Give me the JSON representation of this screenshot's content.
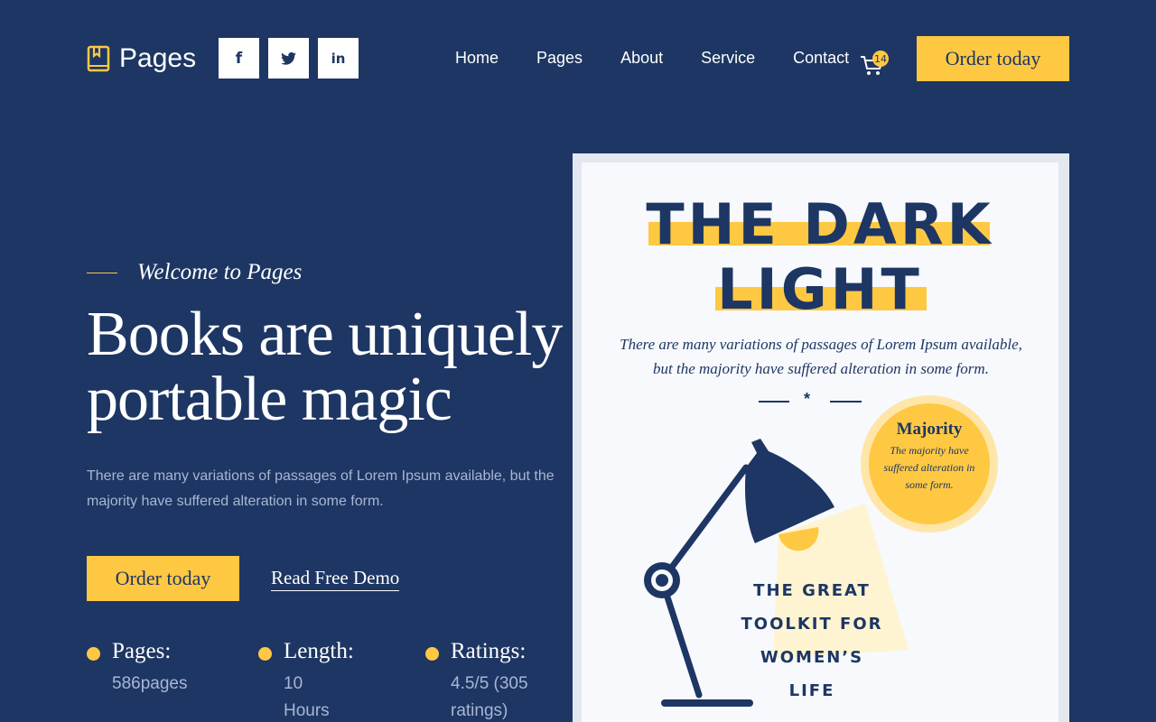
{
  "header": {
    "logo_text": "Pages",
    "social": {
      "facebook": "f",
      "twitter": "t",
      "linkedin": "in"
    },
    "nav": [
      "Home",
      "Pages",
      "About",
      "Service",
      "Contact"
    ],
    "cart_count": "14",
    "cta_label": "Order today"
  },
  "hero": {
    "eyebrow": "Welcome to Pages",
    "title_line1": "Books are uniquely",
    "title_line2": "portable magic",
    "description": "There are many variations of passages of Lorem Ipsum available, but the majority have suffered alteration in some form.",
    "primary_button": "Order today",
    "secondary_button": "Read Free Demo",
    "stats": [
      {
        "label": "Pages:",
        "value": "586pages"
      },
      {
        "label": "Length:",
        "value": "10 Hours"
      },
      {
        "label": "Ratings:",
        "value": "4.5/5 (305 ratings)"
      }
    ]
  },
  "book": {
    "title_line1": "THE DARK",
    "title_line2": "LIGHT",
    "description": "There are many variations of passages of Lorem Ipsum available, but the majority have suffered alteration in some form.",
    "divider_mark": "*",
    "badge_title": "Majority",
    "badge_text": "The majority have suffered alteration in some form.",
    "subtitle_lines": [
      "THE GREAT",
      "TOOLKIT FOR",
      "WOMEN’S",
      "LIFE"
    ]
  },
  "colors": {
    "background": "#1d3663",
    "accent": "#ffc843",
    "muted_text": "#a9b6d3",
    "cover": "#f7f9fd"
  },
  "icons": {
    "logo": "book-icon",
    "cart": "cart-icon",
    "social": [
      "facebook-icon",
      "twitter-icon",
      "linkedin-icon"
    ],
    "illustration": "desk-lamp-icon"
  }
}
